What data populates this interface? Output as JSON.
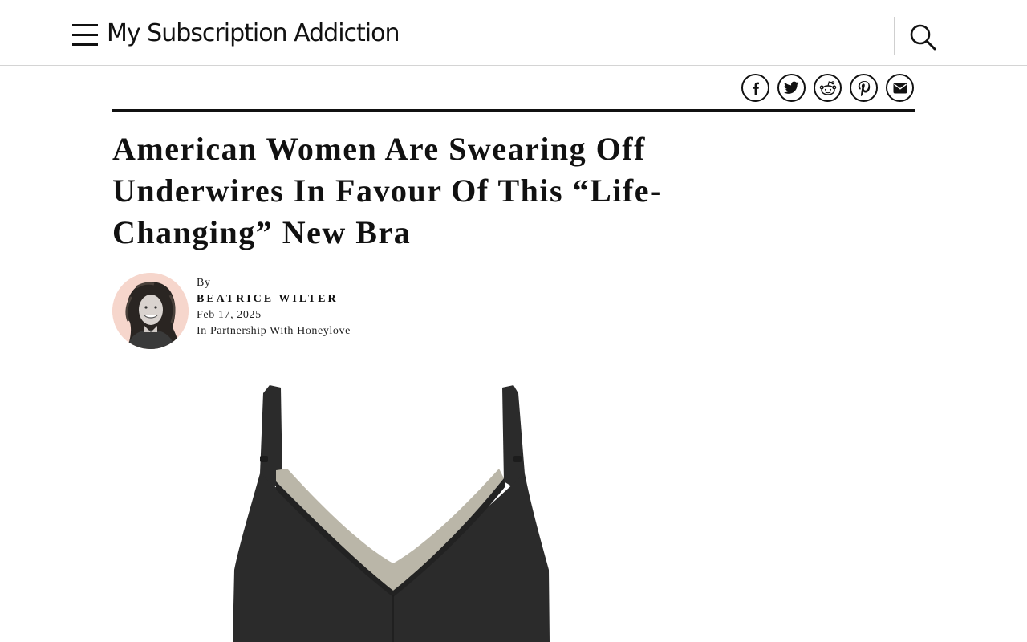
{
  "site": {
    "logo_text": "My Subscription Addiction",
    "menu_icon": "hamburger-menu-icon",
    "search_icon": "magnifying-glass-icon"
  },
  "share": {
    "buttons": [
      {
        "icon": "facebook-icon"
      },
      {
        "icon": "twitter-icon"
      },
      {
        "icon": "reddit-icon"
      },
      {
        "icon": "pinterest-icon"
      },
      {
        "icon": "email-icon"
      }
    ]
  },
  "article": {
    "headline": "American Women Are Swearing Off Underwires In Favour Of This “Life-Changing” New Bra",
    "by_label": "By",
    "author": "BEATRICE WILTER",
    "date": "Feb 17, 2025",
    "partnership": "In Partnership With Honeylove"
  },
  "colors": {
    "text": "#111111",
    "bra_body": "#2b2b2b",
    "bra_mesh": "#bab6a8",
    "avatar_bg": "#f6d6cc"
  }
}
